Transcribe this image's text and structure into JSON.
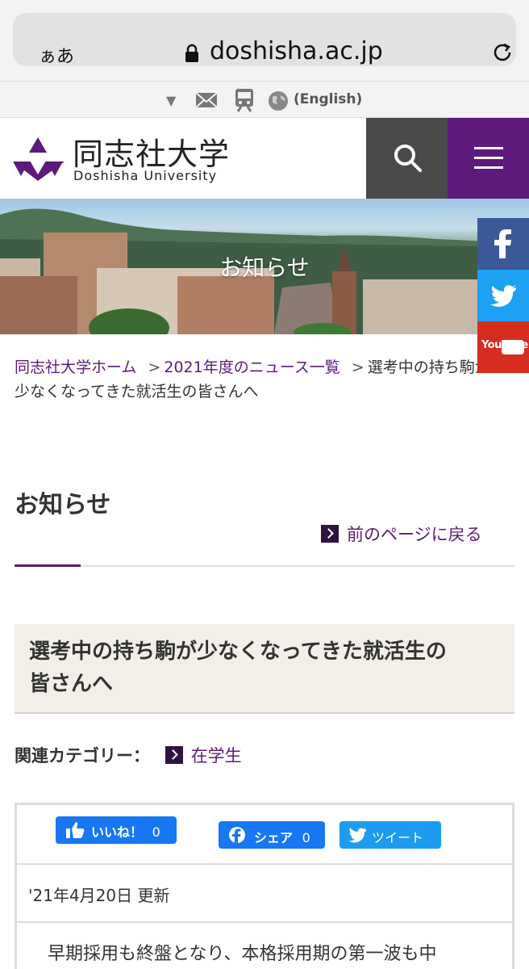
{
  "browser": {
    "aa_label": "ぁあ",
    "url": "doshisha.ac.jp"
  },
  "utility": {
    "english_label": "(English)"
  },
  "header": {
    "logo_jp": "同志社大学",
    "logo_en": "Doshisha University"
  },
  "hero": {
    "title": "お知らせ"
  },
  "social": {
    "youtube_label": "YouTube"
  },
  "breadcrumb": {
    "items": [
      {
        "label": "同志社大学ホーム",
        "sep": ">"
      },
      {
        "label": "2021年度のニュース一覧",
        "sep": ">"
      },
      {
        "label": "選考中の持ち駒が"
      }
    ],
    "current_line2": "少なくなってきた就活生の皆さんへ"
  },
  "section": {
    "title": "お知らせ",
    "back_label": "前のページに戻る"
  },
  "article": {
    "title_line1": "選考中の持ち駒が少なくなってきた就活生の",
    "title_line2": "皆さんへ",
    "category_label": "関連カテゴリー：",
    "category": "在学生",
    "like_label": "いいね！",
    "like_count": "0",
    "share_label": "シェア",
    "share_count": "0",
    "tweet_label": "ツイート",
    "updated": "'21年4月20日 更新",
    "body_first_line": "早期採用も終盤となり、本格採用期の第一波も中"
  },
  "colors": {
    "brand_purple": "#5d1a7a",
    "facebook": "#3b5998",
    "twitter": "#1da1f2",
    "youtube": "#d62d20"
  }
}
